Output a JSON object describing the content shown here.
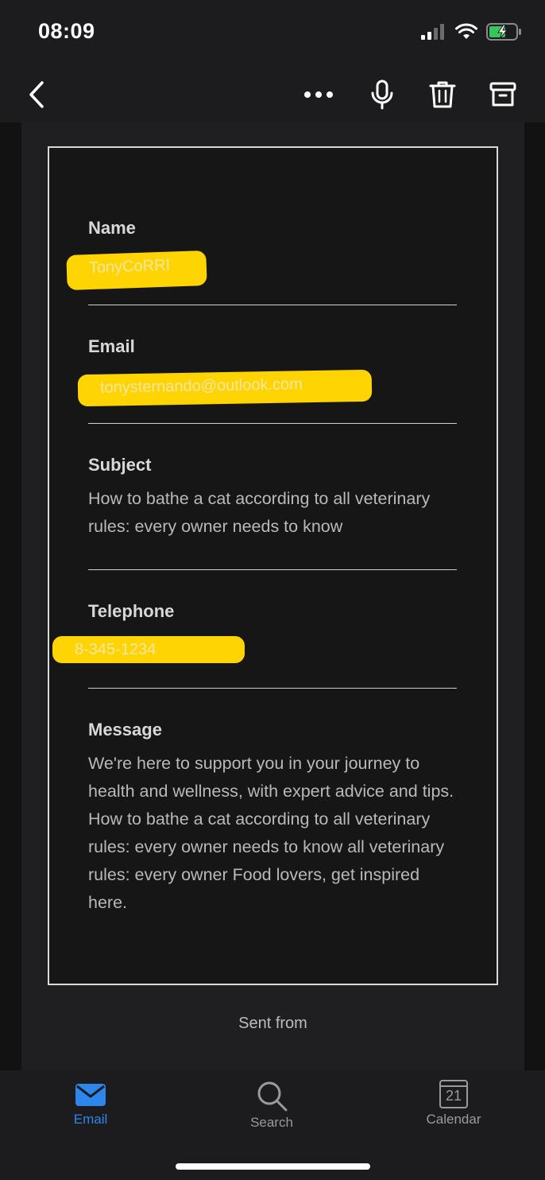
{
  "status_bar": {
    "time": "08:09"
  },
  "toolbar": {
    "back": "chevron-left-icon",
    "more": "more-dots-icon",
    "mic": "microphone-icon",
    "delete": "trash-icon",
    "archive": "archive-icon"
  },
  "message": {
    "fields": [
      {
        "label": "Name",
        "value": "TonyCoRRI"
      },
      {
        "label": "Email",
        "value": "tonysternando@outlook.com"
      },
      {
        "label": "Subject",
        "value": "How to bathe a cat according to all veterinary rules: every owner needs to know"
      },
      {
        "label": "Telephone",
        "value": "8-345-1234"
      },
      {
        "label": "Message",
        "value": "We're here to support you in your journey to health and wellness, with expert advice and tips. How to bathe a cat according to all veterinary rules: every owner needs to know all veterinary rules: every owner Food lovers, get inspired here."
      }
    ],
    "footer": "Sent from"
  },
  "tabs": [
    {
      "label": "Email",
      "active": true,
      "icon": "mail-icon"
    },
    {
      "label": "Search",
      "active": false,
      "icon": "search-icon"
    },
    {
      "label": "Calendar",
      "active": false,
      "icon": "calendar-icon",
      "day": "21"
    }
  ],
  "colors": {
    "accent": "#2d86ea",
    "highlight": "#ffd400",
    "background": "#121212"
  }
}
